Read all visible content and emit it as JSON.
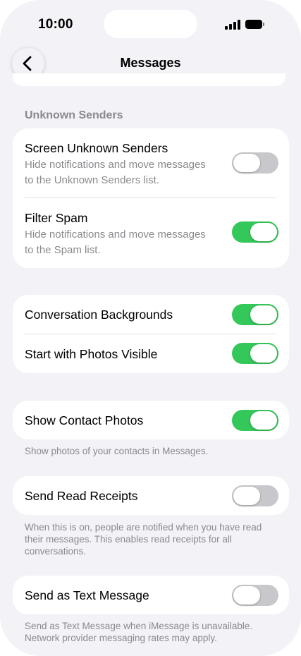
{
  "status_bar": {
    "time": "10:00"
  },
  "nav": {
    "title": "Messages"
  },
  "unknown_senders": {
    "header": "Unknown Senders",
    "screen": {
      "title": "Screen Unknown Senders",
      "line1": "Hide notifications and move messages",
      "line2": "to the Unknown Senders list.",
      "on": false
    },
    "filter_spam": {
      "title": "Filter Spam",
      "line1": "Hide notifications and move messages",
      "line2": "to the Spam list.",
      "on": true
    }
  },
  "display": {
    "backgrounds": {
      "title": "Conversation Backgrounds",
      "on": true
    },
    "photos_visible": {
      "title": "Start with Photos Visible",
      "on": true
    }
  },
  "contact_photos": {
    "title": "Show Contact Photos",
    "on": true,
    "footer": "Show photos of your contacts in Messages."
  },
  "read_receipts": {
    "title": "Send Read Receipts",
    "on": false,
    "footer_line1": "When this is on, people are notified when you have read",
    "footer_line2": "their messages. This enables read receipts for all",
    "footer_line3": "conversations."
  },
  "text_message": {
    "title": "Send as Text Message",
    "on": false,
    "footer_line1": "Send as Text Message when iMessage is unavailable.",
    "footer_line2": "Network provider messaging rates may apply."
  },
  "colors": {
    "toggle_on": "#34c759",
    "toggle_off": "#c8c8cc",
    "background": "#f2f2f7",
    "secondary_text": "#8a8a8e"
  },
  "icons": {
    "back": "chevron-left-icon",
    "signal": "cellular-signal-icon",
    "battery": "battery-icon"
  }
}
